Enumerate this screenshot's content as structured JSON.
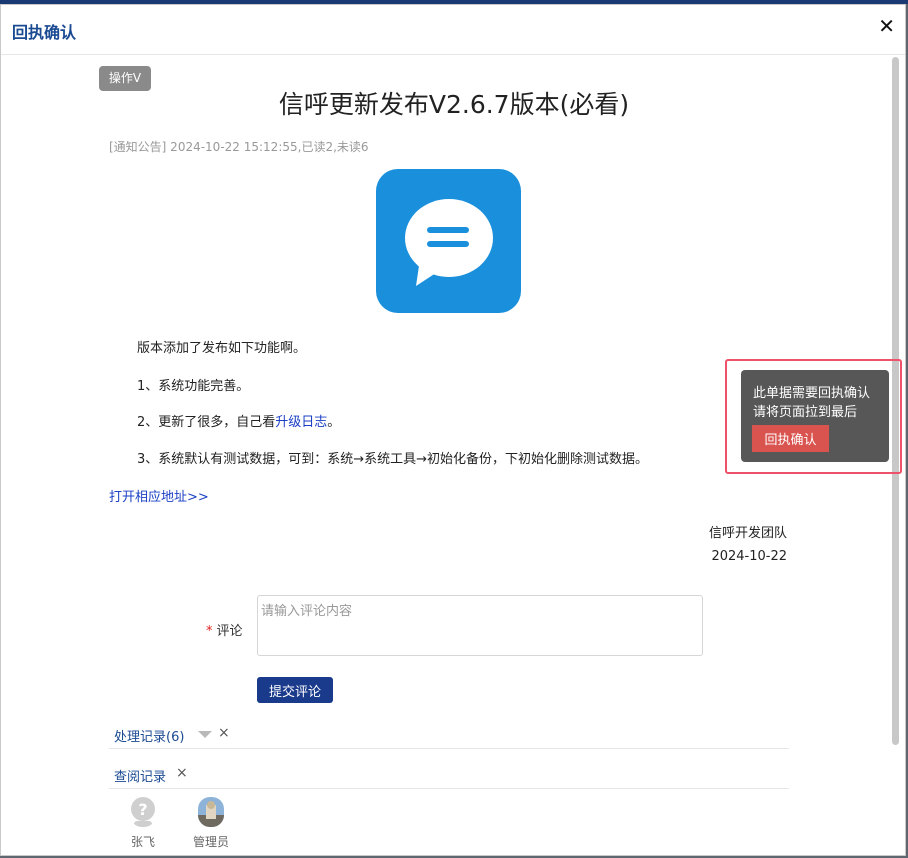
{
  "dialog": {
    "title": "回执确认",
    "close_glyph": "✕"
  },
  "notice": {
    "badge": "操作V",
    "title": "信呼更新发布V2.6.7版本(必看)",
    "meta": "[通知公告] 2024-10-22 15:12:55,已读2,未读6",
    "icon": "chat-bubble-icon",
    "icon_color": "#1a8fdc",
    "intro": "版本添加了发布如下功能啊。",
    "item1": "1、系统功能完善。",
    "item2_prefix": "2、更新了很多，自己看",
    "item2_link": "升级日志",
    "item2_suffix": "。",
    "item3": "3、系统默认有测试数据，可到：系统→系统工具→初始化备份，下初始化删除测试数据。",
    "open_link": "打开相应地址>>",
    "signature_team": "信呼开发团队",
    "signature_date": "2024-10-22"
  },
  "comment": {
    "required_mark": "*",
    "label": "评论",
    "placeholder": "请输入评论内容",
    "submit_label": "提交评论"
  },
  "records": {
    "process_title": "处理记录(6)",
    "view_title": "查阅记录",
    "close_glyph": "×",
    "readers": [
      {
        "name": "张飞",
        "avatar": "placeholder-avatar-icon"
      },
      {
        "name": "管理员",
        "avatar": "photo-avatar-icon"
      }
    ]
  },
  "receipt_tip": {
    "line1": "此单据需要回执确认",
    "line2": "请将页面拉到最后",
    "button_label": "回执确认",
    "button_color": "#d9534f",
    "highlight_color": "#f0516a"
  }
}
